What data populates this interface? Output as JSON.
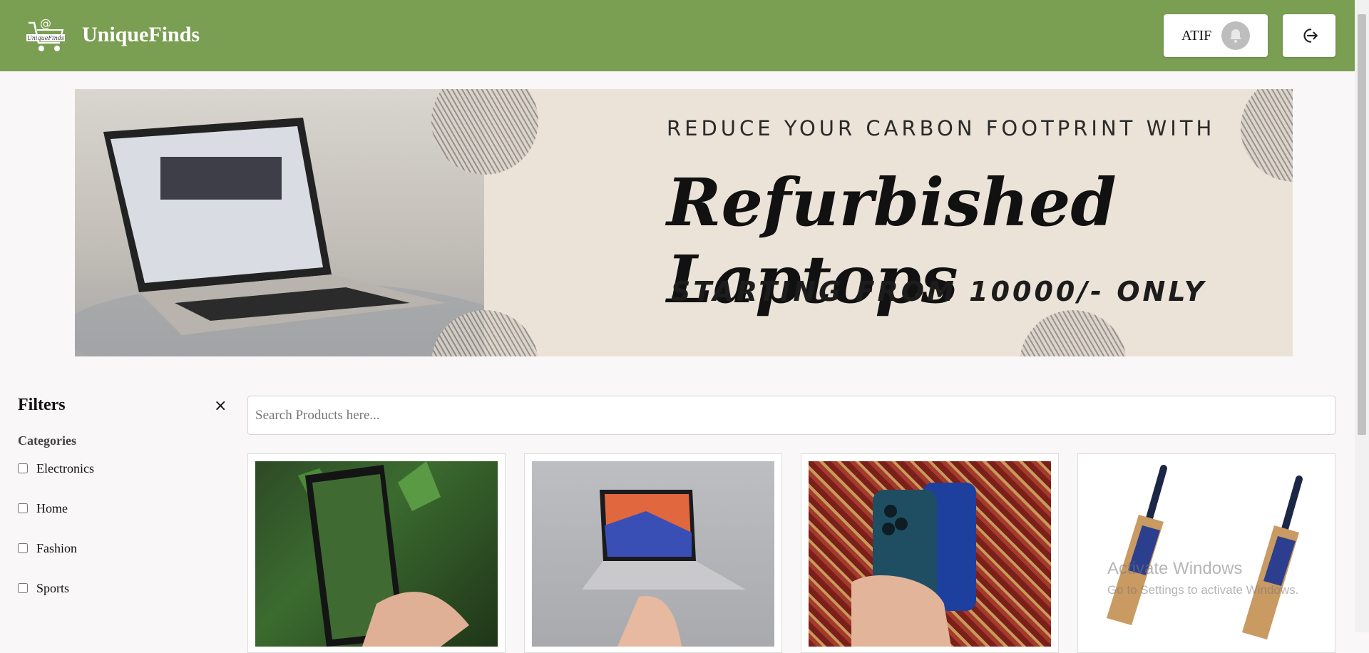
{
  "header": {
    "logo_text": "UniqueFinds",
    "brand": "UniqueFinds",
    "username": "ATIF",
    "colors": {
      "bar": "#7a9e52",
      "text": "#ffffff"
    }
  },
  "banner": {
    "line1": "REDUCE YOUR CARBON FOOTPRINT WITH",
    "line2": "Refurbished Laptops",
    "line3": "STARTING FROM 10000/- ONLY"
  },
  "filters": {
    "title": "Filters",
    "close_icon": "×",
    "categories_title": "Categories",
    "categories": [
      {
        "label": "Electronics",
        "checked": false
      },
      {
        "label": "Home",
        "checked": false
      },
      {
        "label": "Fashion",
        "checked": false
      },
      {
        "label": "Sports",
        "checked": false
      }
    ]
  },
  "search": {
    "placeholder": "Search Products here..."
  },
  "products": [
    {
      "image": "smartphone-photo"
    },
    {
      "image": "laptop-photo"
    },
    {
      "image": "iphone-photo"
    },
    {
      "image": "cricket-bats-photo"
    }
  ],
  "os_watermark": {
    "line1": "Activate Windows",
    "line2": "Go to Settings to activate Windows."
  }
}
